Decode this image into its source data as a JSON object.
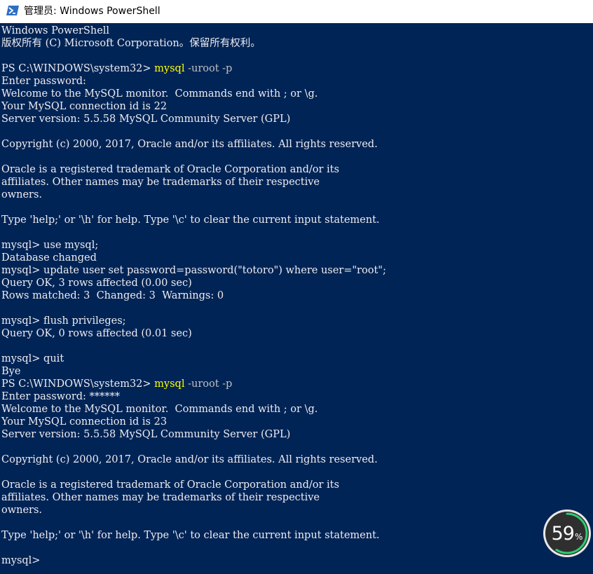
{
  "window": {
    "title": "管理员: Windows PowerShell"
  },
  "console": {
    "lines": [
      {
        "text": "Windows PowerShell"
      },
      {
        "text": "版权所有 (C) Microsoft Corporation。保留所有权利。"
      },
      {
        "text": ""
      },
      {
        "prompt": "PS C:\\WINDOWS\\system32> ",
        "cmd": "mysql",
        "args": " -uroot -p"
      },
      {
        "text": "Enter password:"
      },
      {
        "text": "Welcome to the MySQL monitor.  Commands end with ; or \\g."
      },
      {
        "text": "Your MySQL connection id is 22"
      },
      {
        "text": "Server version: 5.5.58 MySQL Community Server (GPL)"
      },
      {
        "text": ""
      },
      {
        "text": "Copyright (c) 2000, 2017, Oracle and/or its affiliates. All rights reserved."
      },
      {
        "text": ""
      },
      {
        "text": "Oracle is a registered trademark of Oracle Corporation and/or its"
      },
      {
        "text": "affiliates. Other names may be trademarks of their respective"
      },
      {
        "text": "owners."
      },
      {
        "text": ""
      },
      {
        "text": "Type 'help;' or '\\h' for help. Type '\\c' to clear the current input statement."
      },
      {
        "text": ""
      },
      {
        "text": "mysql> use mysql;"
      },
      {
        "text": "Database changed"
      },
      {
        "text": "mysql> update user set password=password(\"totoro\") where user=\"root\";"
      },
      {
        "text": "Query OK, 3 rows affected (0.00 sec)"
      },
      {
        "text": "Rows matched: 3  Changed: 3  Warnings: 0"
      },
      {
        "text": ""
      },
      {
        "text": "mysql> flush privileges;"
      },
      {
        "text": "Query OK, 0 rows affected (0.01 sec)"
      },
      {
        "text": ""
      },
      {
        "text": "mysql> quit"
      },
      {
        "text": "Bye"
      },
      {
        "prompt": "PS C:\\WINDOWS\\system32> ",
        "cmd": "mysql",
        "args": " -uroot -p"
      },
      {
        "text": "Enter password: ******"
      },
      {
        "text": "Welcome to the MySQL monitor.  Commands end with ; or \\g."
      },
      {
        "text": "Your MySQL connection id is 23"
      },
      {
        "text": "Server version: 5.5.58 MySQL Community Server (GPL)"
      },
      {
        "text": ""
      },
      {
        "text": "Copyright (c) 2000, 2017, Oracle and/or its affiliates. All rights reserved."
      },
      {
        "text": ""
      },
      {
        "text": "Oracle is a registered trademark of Oracle Corporation and/or its"
      },
      {
        "text": "affiliates. Other names may be trademarks of their respective"
      },
      {
        "text": "owners."
      },
      {
        "text": ""
      },
      {
        "text": "Type 'help;' or '\\h' for help. Type '\\c' to clear the current input statement."
      },
      {
        "text": ""
      },
      {
        "text": "mysql>"
      }
    ]
  },
  "gauge": {
    "value": "59",
    "unit": "%",
    "fraction": 0.59
  },
  "icons": {
    "window": "powershell-icon",
    "gauge": "memory-gauge-icon"
  },
  "colors": {
    "background": "#012456",
    "text": "#eeedf0",
    "command": "#ffff00",
    "argument": "#c0c0c0",
    "gauge_ring": "#2ecc71",
    "gauge_bg": "#3a3a3a"
  }
}
